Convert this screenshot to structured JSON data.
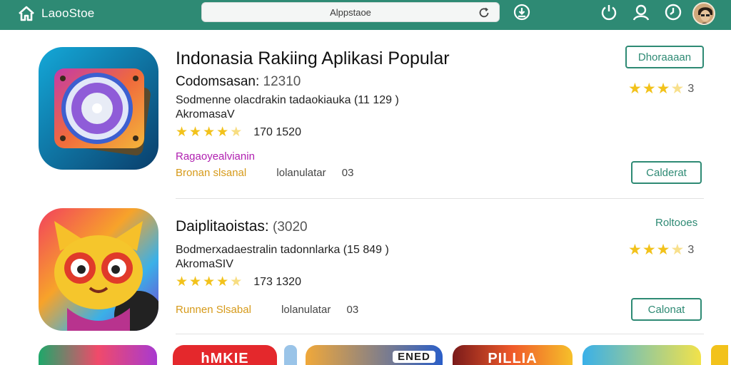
{
  "topbar": {
    "brand": "LaooStoe",
    "search_text": "Alppstaoe",
    "icons": [
      "home-icon",
      "refresh-icon",
      "download-icon",
      "power-icon",
      "user-icon",
      "clock-icon"
    ],
    "accent": "#2e8a74"
  },
  "cards": [
    {
      "title": "Indonasia Rakiing Aplikasi Popular",
      "subhead": "Codomsasan:",
      "subhead_num": "12310",
      "line1": "Sodmenne olacdrakin tadaokiauka  (11 129 )",
      "line2": "AkromasaV",
      "rating_count": "170 1520",
      "tag": "Ragaoyealvianin",
      "meta_gold": "Bronan slsanal",
      "meta_gray": "lolanulatar",
      "meta_num": "03",
      "top_button": "Dhoraaaan",
      "right_rating": "3",
      "bottom_button": "Calderat",
      "icon": "disc-app-icon"
    },
    {
      "title": "",
      "subhead": "Daiplitaoistas:",
      "subhead_num": "(3020",
      "line1": "Bodmerxadaestralin tadonnlarka  (15 849 )",
      "line2": "AkromaSIV",
      "rating_count": "173 1320",
      "tag": "",
      "meta_gold": "Runnen Slsabal",
      "meta_gray": "lolanulatar",
      "meta_num": "03",
      "top_link": "Roltooes",
      "right_rating": "3",
      "bottom_button": "Calonat",
      "icon": "fox-character-app-icon"
    }
  ],
  "bottom_tiles": [
    "",
    "hMKIE",
    "ENED",
    "PILLIA",
    "",
    ""
  ]
}
